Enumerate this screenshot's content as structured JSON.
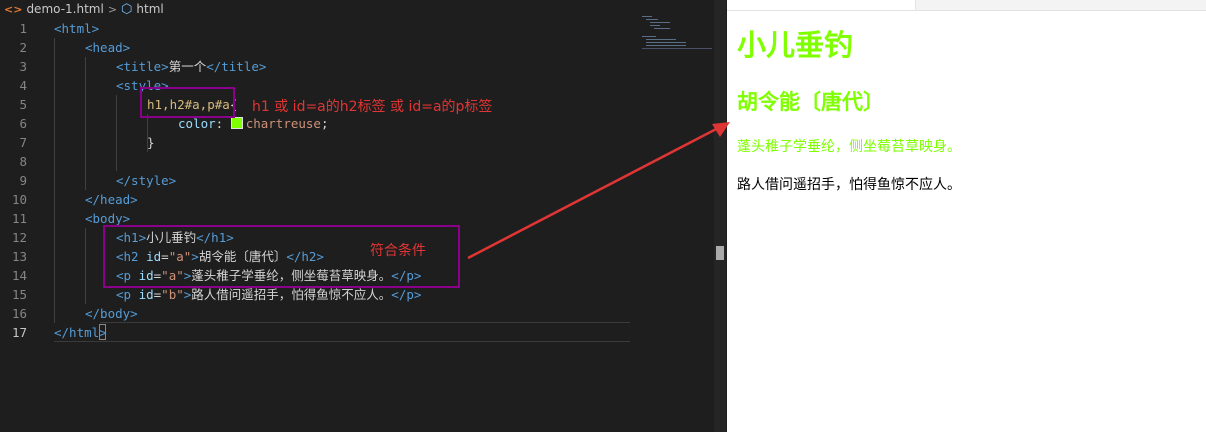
{
  "breadcrumb": {
    "file": "demo-1.html",
    "node": "html"
  },
  "code_lines": [
    {
      "n": "1",
      "parts": [
        [
          "tag",
          "<html>"
        ]
      ]
    },
    {
      "n": "2",
      "parts": [
        [
          "tag",
          "<head>"
        ]
      ]
    },
    {
      "n": "3",
      "parts": [
        [
          "tag",
          "<title>"
        ],
        [
          "txt",
          "第一个"
        ],
        [
          "tag",
          "</title>"
        ]
      ]
    },
    {
      "n": "4",
      "parts": [
        [
          "tag",
          "<style>"
        ]
      ]
    },
    {
      "n": "5",
      "parts": [
        [
          "sel",
          "h1,h2#a,p#a"
        ],
        [
          "txt",
          "{"
        ]
      ]
    },
    {
      "n": "6",
      "parts": [
        [
          "prop",
          "color"
        ],
        [
          "txt",
          ": "
        ],
        [
          "swatch",
          ""
        ],
        [
          "val",
          "chartreuse"
        ],
        [
          "txt",
          ";"
        ]
      ]
    },
    {
      "n": "7",
      "parts": [
        [
          "txt",
          "}"
        ]
      ]
    },
    {
      "n": "8",
      "parts": []
    },
    {
      "n": "9",
      "parts": [
        [
          "tag",
          "</style>"
        ]
      ]
    },
    {
      "n": "10",
      "parts": [
        [
          "tag",
          "</head>"
        ]
      ]
    },
    {
      "n": "11",
      "parts": [
        [
          "tag",
          "<body>"
        ]
      ]
    },
    {
      "n": "12",
      "parts": [
        [
          "tag",
          "<h1>"
        ],
        [
          "txt",
          "小儿垂钓"
        ],
        [
          "tag",
          "</h1>"
        ]
      ]
    },
    {
      "n": "13",
      "parts": [
        [
          "tag",
          "<h2 "
        ],
        [
          "attr",
          "id"
        ],
        [
          "txt",
          "="
        ],
        [
          "str",
          "\"a\""
        ],
        [
          "tag",
          ">"
        ],
        [
          "txt",
          "胡令能〔唐代〕"
        ],
        [
          "tag",
          "</h2>"
        ]
      ]
    },
    {
      "n": "14",
      "parts": [
        [
          "tag",
          "<p "
        ],
        [
          "attr",
          "id"
        ],
        [
          "txt",
          "="
        ],
        [
          "str",
          "\"a\""
        ],
        [
          "tag",
          ">"
        ],
        [
          "txt",
          "蓬头稚子学垂纶，侧坐莓苔草映身。"
        ],
        [
          "tag",
          "</p>"
        ]
      ]
    },
    {
      "n": "15",
      "parts": [
        [
          "tag",
          "<p "
        ],
        [
          "attr",
          "id"
        ],
        [
          "txt",
          "="
        ],
        [
          "str",
          "\"b\""
        ],
        [
          "tag",
          ">"
        ],
        [
          "txt",
          "路人借问遥招手，怕得鱼惊不应人。"
        ],
        [
          "tag",
          "</p>"
        ]
      ]
    },
    {
      "n": "16",
      "parts": [
        [
          "tag",
          "</body>"
        ]
      ]
    },
    {
      "n": "17",
      "parts": [
        [
          "tag",
          "</html>"
        ]
      ]
    }
  ],
  "annotations": {
    "selector_note": "h1 或 id=a的h2标签 或 id=a的p标签",
    "match_note": "符合条件"
  },
  "preview": {
    "h1": "小儿垂钓",
    "h2": "胡令能〔唐代〕",
    "p1": "蓬头稚子学垂纶，侧坐莓苔草映身。",
    "p2": "路人借问遥招手，怕得鱼惊不应人。"
  },
  "colors": {
    "chartreuse": "#7fff00",
    "annotation_red": "#e03535",
    "highlight_box": "#8b008b"
  },
  "icons": [
    "html-file-icon",
    "chevron-right-icon",
    "cube-icon"
  ]
}
